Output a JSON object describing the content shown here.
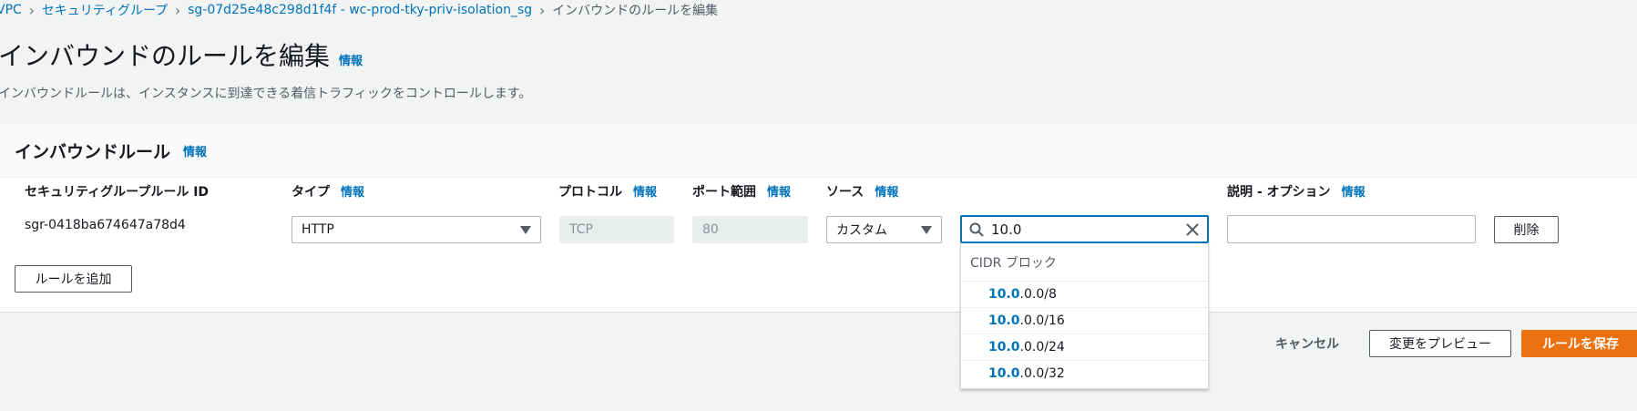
{
  "breadcrumb": {
    "items": [
      "VPC",
      "セキュリティグループ",
      "sg-07d25e48c298d1f4f - wc-prod-tky-priv-isolation_sg"
    ],
    "current": "インバウンドのルールを編集"
  },
  "page": {
    "title": "インバウンドのルールを編集",
    "info": "情報",
    "description": "インバウンドルールは、インスタンスに到達できる着信トラフィックをコントロールします。"
  },
  "panel": {
    "title": "インバウンドルール",
    "info": "情報"
  },
  "columns": {
    "rule_id": "セキュリティグループルール ID",
    "type": "タイプ",
    "protocol": "プロトコル",
    "port_range": "ポート範囲",
    "source": "ソース",
    "description": "説明 - オプション",
    "info": "情報"
  },
  "rule": {
    "id": "sgr-0418ba674647a78d4",
    "type": "HTTP",
    "protocol": "TCP",
    "port_range": "80",
    "source_type": "カスタム",
    "source_search": "10.0",
    "description": "",
    "delete_label": "削除"
  },
  "dropdown": {
    "group_label": "CIDR ブロック",
    "match": "10.0",
    "options": [
      {
        "match": "10.0",
        "rest": ".0.0/8"
      },
      {
        "match": "10.0",
        "rest": ".0.0/16"
      },
      {
        "match": "10.0",
        "rest": ".0.0/24"
      },
      {
        "match": "10.0",
        "rest": ".0.0/32"
      }
    ]
  },
  "add_rule_label": "ルールを追加",
  "footer": {
    "cancel": "キャンセル",
    "preview": "変更をプレビュー",
    "save": "ルールを保存"
  },
  "colors": {
    "link": "#0073bb",
    "primary": "#ec7211",
    "focus": "#0073bb"
  },
  "icons": [
    "chevron-right-icon",
    "caret-down-icon",
    "search-icon",
    "clear-icon"
  ]
}
